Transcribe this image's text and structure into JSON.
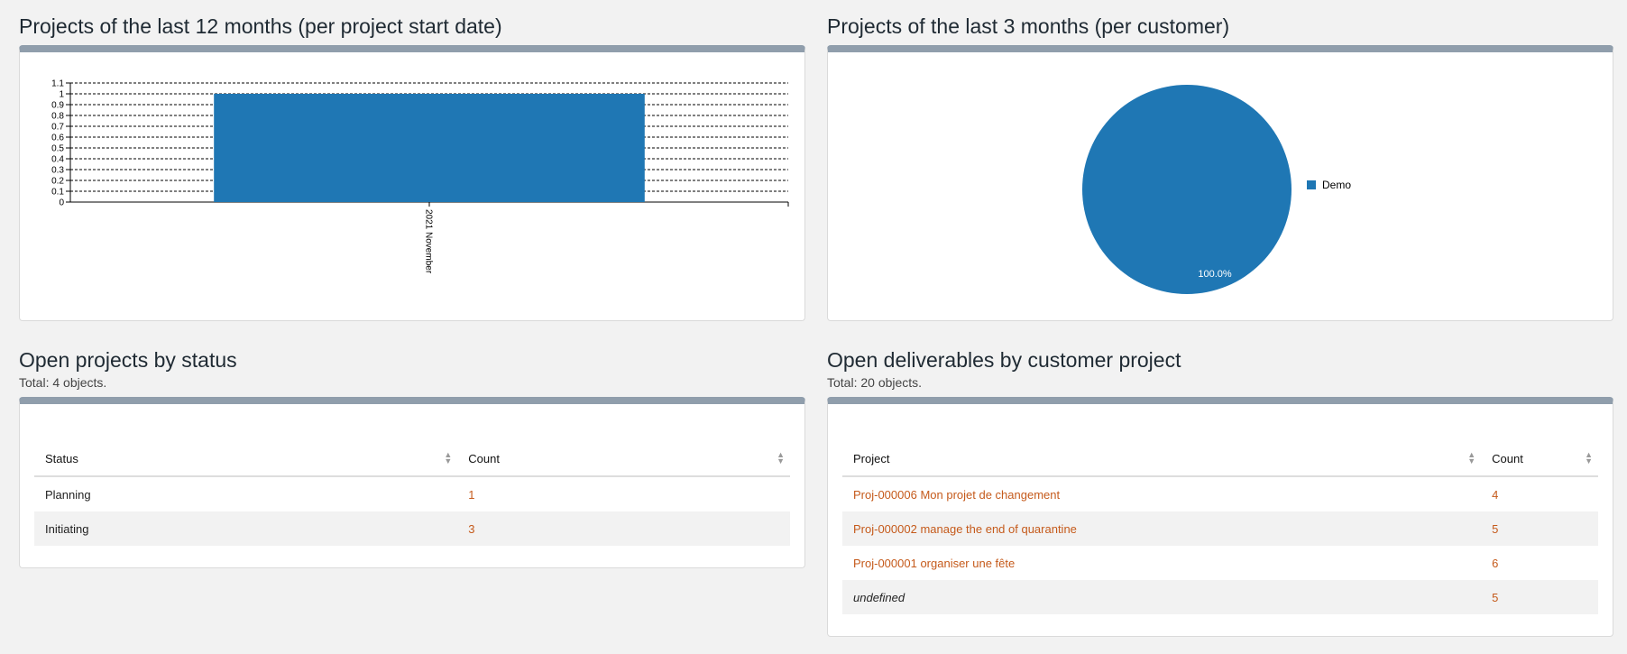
{
  "widgets": {
    "projects_12m": {
      "title": "Projects of the last 12 months (per project start date)"
    },
    "projects_3m": {
      "title": "Projects of the last 3 months (per customer)"
    },
    "open_by_status": {
      "title": "Open projects by status",
      "total": "Total: 4 objects.",
      "columns": [
        "Status",
        "Count"
      ],
      "rows": [
        {
          "status": "Planning",
          "count": "1"
        },
        {
          "status": "Initiating",
          "count": "3"
        }
      ]
    },
    "open_deliverables": {
      "title": "Open deliverables by customer project",
      "total": "Total: 20 objects.",
      "columns": [
        "Project",
        "Count"
      ],
      "rows": [
        {
          "project": "Proj-000006 Mon projet de changement",
          "count": "4"
        },
        {
          "project": "Proj-000002 manage the end of quarantine",
          "count": "5"
        },
        {
          "project": "Proj-000001 organiser une fête",
          "count": "6"
        },
        {
          "project": "undefined",
          "count": "5"
        }
      ]
    }
  },
  "colors": {
    "series": "#1f77b4",
    "link": "#c55a1b",
    "panel_header": "#909eac"
  },
  "chart_data": [
    {
      "type": "bar",
      "categories": [
        "2021 November"
      ],
      "values": [
        1
      ],
      "ylim": [
        0,
        1.1
      ],
      "yticks": [
        "0",
        "0.1",
        "0.2",
        "0.3",
        "0.4",
        "0.5",
        "0.6",
        "0.7",
        "0.8",
        "0.9",
        "1",
        "1.1"
      ],
      "grid": true
    },
    {
      "type": "pie",
      "labels": [
        "Demo"
      ],
      "values": [
        100
      ],
      "slice_label": "100.0%",
      "legend": "right"
    }
  ]
}
